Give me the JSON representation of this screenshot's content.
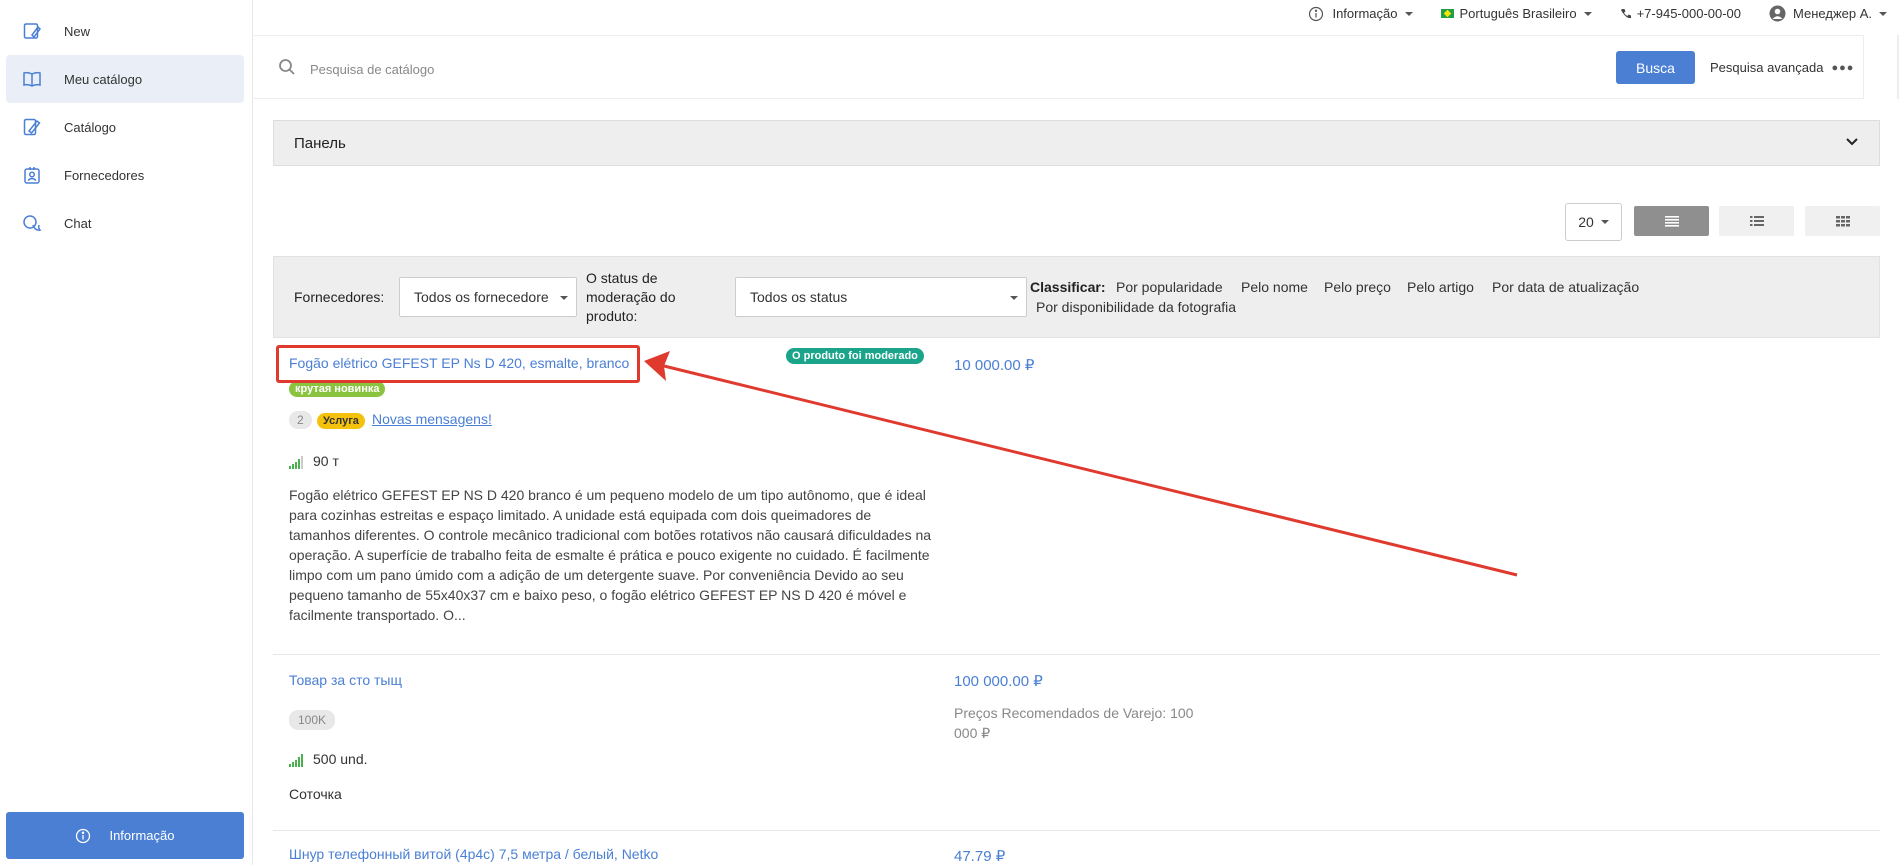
{
  "sidebar": {
    "items": [
      {
        "label": "New",
        "icon": "new-catalog-icon",
        "active": false
      },
      {
        "label": "Meu catálogo",
        "icon": "book-icon",
        "active": true
      },
      {
        "label": "Catálogo",
        "icon": "catalog-icon",
        "active": false
      },
      {
        "label": "Fornecedores",
        "icon": "supplier-badge-icon",
        "active": false
      },
      {
        "label": "Chat",
        "icon": "chat-icon",
        "active": false
      }
    ],
    "info_button": "Informação"
  },
  "topbar": {
    "info": "Informação",
    "language": "Português Brasileiro",
    "phone": "+7-945-000-00-00",
    "user": "Менеджер А."
  },
  "search": {
    "placeholder": "Pesquisa de catálogo",
    "button": "Busca",
    "advanced": "Pesquisa avançada"
  },
  "panel": {
    "title": "Панель"
  },
  "view": {
    "per_page": "20",
    "active_view": "list-compact"
  },
  "filters": {
    "suppliers_label": "Fornecedores:",
    "suppliers_value": "Todos os fornecedore",
    "status_label_1": "O status de",
    "status_label_2": "moderação do",
    "status_label_3": "produto:",
    "status_value": "Todos os status",
    "sort_label": "Classificar:",
    "sort_options": [
      "Por popularidade",
      "Pelo nome",
      "Pelo preço",
      "Pelo artigo",
      "Por data de atualização",
      "Por disponibilidade da fotografia"
    ]
  },
  "products": [
    {
      "title": "Fogão elétrico GEFEST EP Ns D 420, esmalte, branco",
      "moderation_badge": "O produto foi moderado",
      "tag": "крутая новинка",
      "msg_count": "2",
      "service_badge": "Услуга",
      "new_messages": "Novas mensagens!",
      "stock": "90 т",
      "price": "10 000.00 ₽",
      "description": "Fogão elétrico GEFEST EP NS D 420 branco é um pequeno modelo de um tipo autônomo, que é ideal para cozinhas estreitas e espaço limitado. A unidade está equipada com dois queimadores de tamanhos diferentes. O controle mecânico tradicional com botões rotativos não causará dificuldades na operação. A superfície de trabalho feita de esmalte é prática e pouco exigente no cuidado. É facilmente limpo com um pano úmido com a adição de um detergente suave. Por conveniência Devido ao seu pequeno tamanho de 55x40x37 cm e baixo peso, o fogão elétrico GEFEST EP NS D 420 é móvel e facilmente transportado. O..."
    },
    {
      "title": "Товар за сто тыщ",
      "tag": "100K",
      "stock": "500 und.",
      "price": "100 000.00 ₽",
      "rrp_line1": "Preços Recomendados de Varejo: 100",
      "rrp_line2": "000 ₽",
      "note": "Соточка"
    },
    {
      "title": "Шнур телефонный витой (4p4c) 7,5 метра / белый, Netko",
      "price": "47.79 ₽"
    }
  ],
  "colors": {
    "accent": "#4a7fd4",
    "moderated": "#1aa58a",
    "tag_green": "#8ac43f",
    "service_yellow": "#f4c20d",
    "annotation_red": "#e03a2f"
  }
}
